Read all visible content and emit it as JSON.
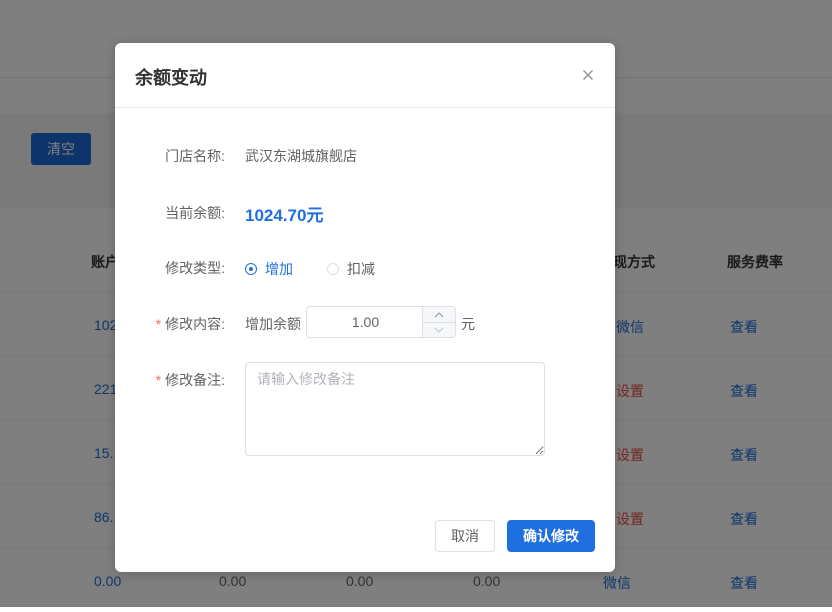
{
  "background": {
    "clear_button": "清空",
    "table": {
      "headers": {
        "account": "账户",
        "withdraw_method": "现方式",
        "service_rate": "服务费率"
      },
      "rows": [
        {
          "account": "102",
          "method": "微信",
          "method_color": "blue",
          "action": "查看"
        },
        {
          "account": "221",
          "method": "设置",
          "method_color": "red",
          "action": "查看"
        },
        {
          "account": "15.",
          "method": "设置",
          "method_color": "red",
          "action": "查看"
        },
        {
          "account": "86.",
          "method": "设置",
          "method_color": "red",
          "action": "查看"
        },
        {
          "account": "0.00",
          "col2": "0.00",
          "col3": "0.00",
          "col4": "0.00",
          "method": "微信",
          "method_color": "blue",
          "action": "查看"
        }
      ]
    }
  },
  "dialog": {
    "title": "余额变动",
    "close_icon": "close-icon",
    "store_label": "门店名称:",
    "store_value": "武汉东湖城旗舰店",
    "balance_label": "当前余额:",
    "balance_value": "1024.70元",
    "type_label": "修改类型:",
    "type_options": [
      {
        "label": "增加",
        "checked": true
      },
      {
        "label": "扣减",
        "checked": false
      }
    ],
    "content_label": "修改内容:",
    "content_prefix": "增加余额",
    "content_value": "1.00",
    "content_unit": "元",
    "note_label": "修改备注:",
    "note_placeholder": "请输入修改备注",
    "required_mark": "*",
    "cancel_label": "取消",
    "confirm_label": "确认修改"
  },
  "colors": {
    "primary": "#1f6fe0",
    "danger": "#e54d42",
    "required": "#f56c6c"
  }
}
